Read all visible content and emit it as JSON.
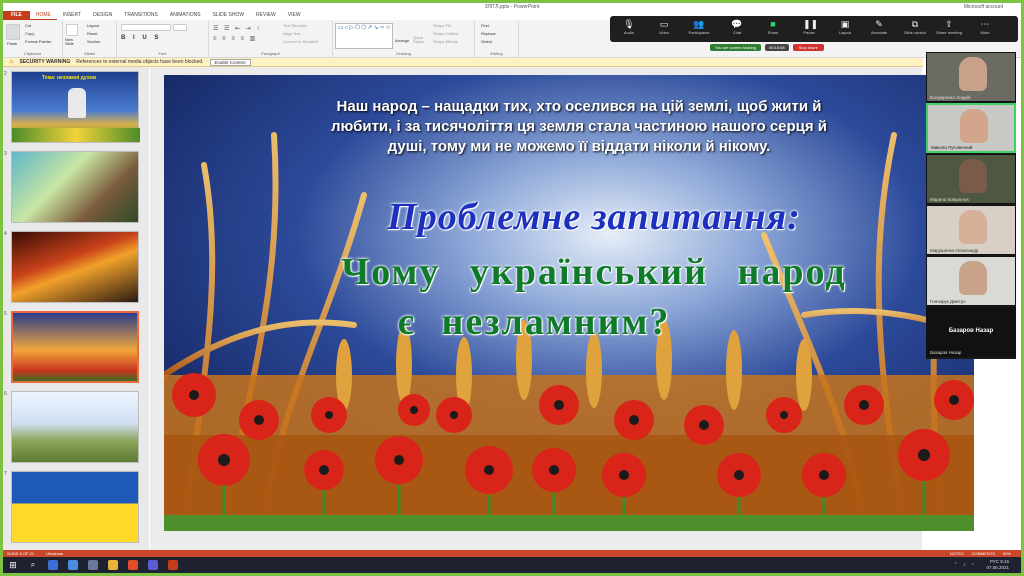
{
  "window": {
    "title": "ЗЛІТЛ.pptx - PowerPoint",
    "account": "Microsoft account"
  },
  "ribbon_tabs": [
    "FILE",
    "HOME",
    "INSERT",
    "DESIGN",
    "TRANSITIONS",
    "ANIMATIONS",
    "SLIDE SHOW",
    "REVIEW",
    "VIEW"
  ],
  "ribbon": {
    "clipboard": {
      "paste": "Paste",
      "cut": "Cut",
      "copy": "Copy",
      "format_painter": "Format Painter",
      "label": "Clipboard"
    },
    "slides": {
      "new_slide": "New Slide",
      "layout": "Layout",
      "reset": "Reset",
      "section": "Section",
      "label": "Slides"
    },
    "font": {
      "label": "Font"
    },
    "paragraph": {
      "text_direction": "Text Direction",
      "align_text": "Align Text",
      "convert": "Convert to SmartArt",
      "label": "Paragraph"
    },
    "drawing": {
      "arrange": "Arrange",
      "quick_styles": "Quick Styles",
      "shape_fill": "Shape Fill",
      "shape_outline": "Shape Outline",
      "shape_effects": "Shape Effects",
      "label": "Drawing"
    },
    "editing": {
      "find": "Find",
      "replace": "Replace",
      "select": "Select",
      "label": "Editing"
    }
  },
  "zoom_controls": [
    {
      "label": "Audio",
      "icon": "mic-icon"
    },
    {
      "label": "Video",
      "icon": "video-icon"
    },
    {
      "label": "Participants",
      "icon": "participants-icon"
    },
    {
      "label": "Chat",
      "icon": "chat-icon"
    },
    {
      "label": "Share",
      "icon": "share-icon"
    },
    {
      "label": "Pause",
      "icon": "pause-icon"
    },
    {
      "label": "Layout",
      "icon": "layout-icon"
    },
    {
      "label": "Annotate",
      "icon": "annotate-icon"
    },
    {
      "label": "Slide control",
      "icon": "slide-control-icon"
    },
    {
      "label": "Share meeting",
      "icon": "share-meeting-icon"
    },
    {
      "label": "More",
      "icon": "more-icon"
    }
  ],
  "share_bar": {
    "status": "You are screen sharing",
    "timer": "00:15:08",
    "stop": "Stop share"
  },
  "security": {
    "label": "SECURITY WARNING",
    "message": "References to external media objects have been blocked.",
    "button": "Enable Content"
  },
  "thumbnails": [
    {
      "num": "2",
      "title": "Тема: незламні духом"
    },
    {
      "num": "3",
      "title": ""
    },
    {
      "num": "4",
      "title": ""
    },
    {
      "num": "5",
      "title": ""
    },
    {
      "num": "6",
      "title": ""
    },
    {
      "num": "7",
      "title": ""
    }
  ],
  "slide": {
    "intro_text": "Наш народ – нащадки тих, хто оселився на цій землі, щоб жити й любити, і за тисячоліття ця земля стала частиною нашого серця й душі, тому ми не можемо її віддати  ніколи й  нікому.",
    "heading": "Проблемне запитання:",
    "question_line1": "Чому  український  народ",
    "question_line2": "є  незламним?"
  },
  "participants": [
    {
      "name": "Бондаренко Андрій",
      "active": false
    },
    {
      "name": "Микола Пуговичний",
      "active": true
    },
    {
      "name": "Марина Ковальчук",
      "active": false
    },
    {
      "name": "Марушенко Олександр",
      "active": false
    },
    {
      "name": "Гончарук Дмитро",
      "active": false
    },
    {
      "name": "Базаров Назар",
      "active": false
    }
  ],
  "participant_big_name": "Базаров Назар",
  "status": {
    "slide": "SLIDE 5 OF 21",
    "lang": "Ukrainian",
    "notes": "NOTES",
    "comments": "COMMENTS",
    "zoom": "50%"
  },
  "tray": {
    "lang": "РУС",
    "time": "9:15",
    "date": "07.06.2021"
  }
}
